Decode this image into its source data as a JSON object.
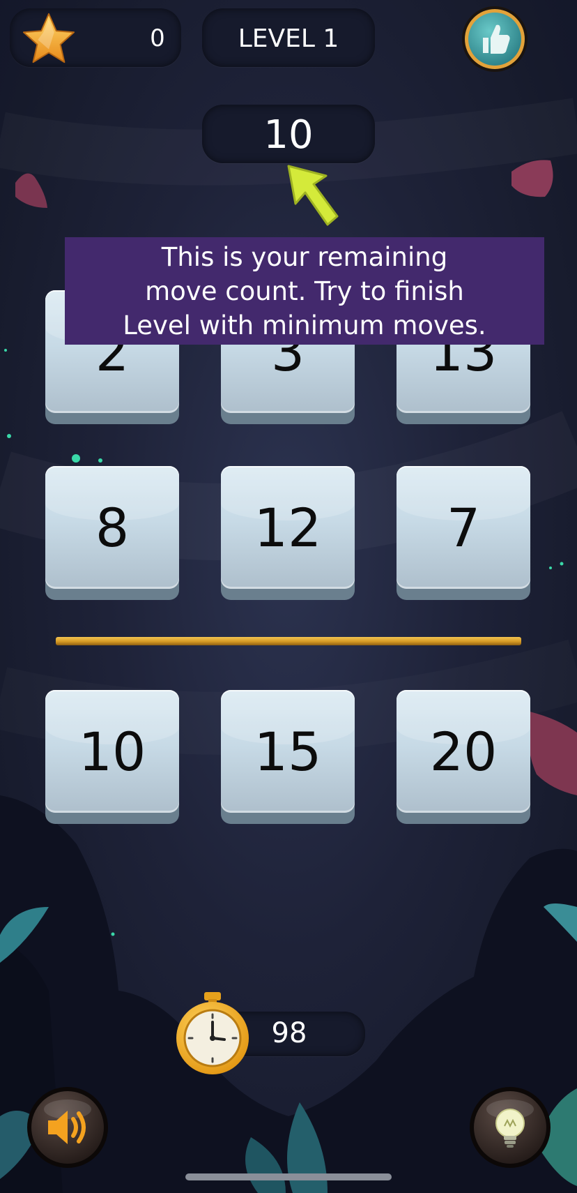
{
  "hud": {
    "score": "0",
    "level": "LEVEL 1",
    "moves": "10",
    "timer": "98"
  },
  "tooltip": {
    "line1": "This is your remaining",
    "line2": "move count. Try to finish",
    "line3": "Level with minimum moves."
  },
  "grid": {
    "rows": [
      [
        "2",
        "3",
        "13"
      ],
      [
        "8",
        "12",
        "7"
      ]
    ],
    "answers": [
      "10",
      "15",
      "20"
    ]
  },
  "colors": {
    "tooltip_bg": "#43296d",
    "tile_face": "#c7dae6",
    "divider_gold": "#d69a24",
    "arrow": "#d4ea3a",
    "like_button": "#3e9ea1"
  },
  "icons": {
    "score": "star-icon",
    "like": "thumbs-up-icon",
    "pointer": "arrow-pointer-icon",
    "timer": "stopwatch-icon",
    "sound": "speaker-icon",
    "hint": "lightbulb-icon"
  }
}
